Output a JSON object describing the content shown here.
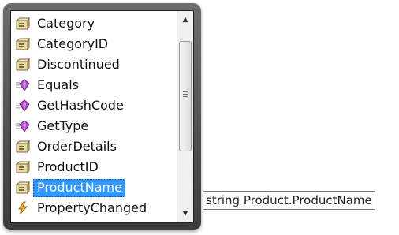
{
  "list": {
    "items": [
      {
        "label": "Category",
        "icon": "property-icon"
      },
      {
        "label": "CategoryID",
        "icon": "property-icon"
      },
      {
        "label": "Discontinued",
        "icon": "property-icon"
      },
      {
        "label": "Equals",
        "icon": "method-icon"
      },
      {
        "label": "GetHashCode",
        "icon": "method-icon"
      },
      {
        "label": "GetType",
        "icon": "method-icon"
      },
      {
        "label": "OrderDetails",
        "icon": "property-icon"
      },
      {
        "label": "ProductID",
        "icon": "property-icon"
      },
      {
        "label": "ProductName",
        "icon": "property-icon",
        "selected": true
      },
      {
        "label": "PropertyChanged",
        "icon": "event-icon"
      }
    ]
  },
  "tooltip": {
    "text": "string Product.ProductName"
  },
  "scrollbar": {
    "up_glyph": "▲",
    "down_glyph": "▼"
  },
  "colors": {
    "selection": "#3399ff",
    "frame": "#4a4a4a"
  }
}
